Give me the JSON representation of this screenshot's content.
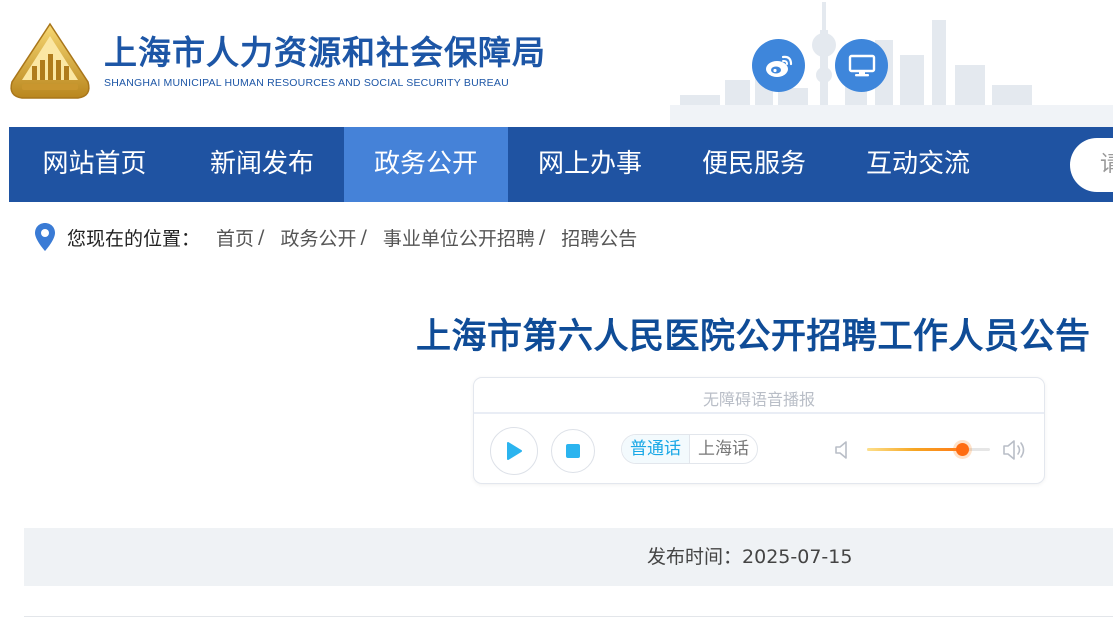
{
  "header": {
    "title": "上海市人力资源和社会保障局",
    "subtitle": "SHANGHAI MUNICIPAL HUMAN RESOURCES AND SOCIAL SECURITY BUREAU"
  },
  "nav": {
    "items": [
      {
        "label": "网站首页",
        "active": false
      },
      {
        "label": "新闻发布",
        "active": false
      },
      {
        "label": "政务公开",
        "active": true
      },
      {
        "label": "网上办事",
        "active": false
      },
      {
        "label": "便民服务",
        "active": false
      },
      {
        "label": "互动交流",
        "active": false
      }
    ],
    "search_placeholder": "请"
  },
  "breadcrumb": {
    "prefix": "您现在的位置：",
    "items": [
      "首页",
      "政务公开",
      "事业单位公开招聘",
      "招聘公告"
    ],
    "separator": "/"
  },
  "article": {
    "title": "上海市第六人民医院公开招聘工作人员公告",
    "publish_label": "发布时间：",
    "publish_date": "2025-07-15"
  },
  "audio_player": {
    "label": "无障碍语音播报",
    "languages": [
      {
        "label": "普通话",
        "active": true
      },
      {
        "label": "上海话",
        "active": false
      }
    ],
    "volume_fraction": 0.77
  },
  "colors": {
    "nav_bg": "#1f53a2",
    "nav_active": "#4582d8",
    "brand_blue": "#1d56a6",
    "title_blue": "#0f4c97",
    "player_accent": "#2bb4ef",
    "volume_knob": "#ff6d12"
  },
  "icons": {
    "emblem": "bureau-emblem-icon",
    "weibo": "weibo-icon",
    "pc": "monitor-icon",
    "location": "location-pin-icon",
    "play": "play-icon",
    "stop": "stop-icon",
    "volume_low": "volume-low-icon",
    "volume_high": "volume-high-icon"
  }
}
